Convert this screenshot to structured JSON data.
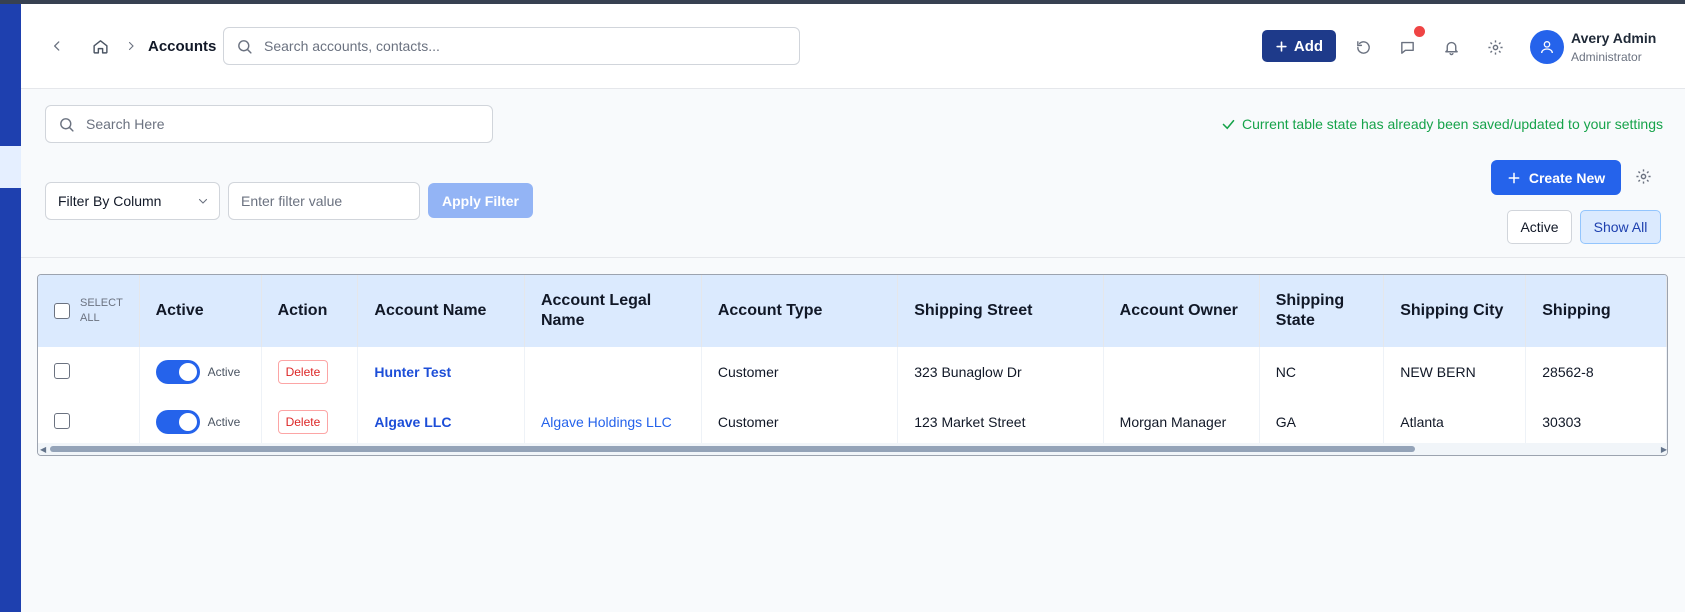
{
  "header": {
    "breadcrumb_current": "Accounts",
    "search_placeholder": "Search accounts, contacts...",
    "add_label": "Add",
    "user_name": "Avery Admin",
    "user_role": "Administrator"
  },
  "controls": {
    "table_search_placeholder": "Search Here",
    "saved_message": "Current table state has already been saved/updated to your settings",
    "filter_column_label": "Filter By Column",
    "filter_value_placeholder": "Enter filter value",
    "apply_filter_label": "Apply Filter",
    "create_new_label": "Create New",
    "active_label": "Active",
    "show_all_label": "Show All"
  },
  "table": {
    "select_all_label": "SELECT ALL",
    "columns": [
      "Active",
      "Action",
      "Account Name",
      "Account Legal Name",
      "Account Type",
      "Shipping Street",
      "Account Owner",
      "Shipping State",
      "Shipping City",
      "Shipping"
    ],
    "rows": [
      {
        "active_label": "Active",
        "action_label": "Delete",
        "account_name": "Hunter Test",
        "legal_name": "",
        "account_type": "Customer",
        "shipping_street": "323 Bunaglow Dr",
        "account_owner": "",
        "shipping_state": "NC",
        "shipping_city": "NEW BERN",
        "shipping_zip": "28562-8"
      },
      {
        "active_label": "Active",
        "action_label": "Delete",
        "account_name": "Algave LLC",
        "legal_name": "Algave Holdings LLC",
        "account_type": "Customer",
        "shipping_street": "123 Market Street",
        "account_owner": "Morgan Manager",
        "shipping_state": "GA",
        "shipping_city": "Atlanta",
        "shipping_zip": "30303"
      }
    ]
  },
  "colors": {
    "primary": "#2563eb",
    "dark_primary": "#1e3a8a",
    "success": "#16a34a",
    "danger": "#dc2626",
    "header_bg": "#dbeafe"
  },
  "icons": [
    "back-chevron-icon",
    "home-icon",
    "chevron-right-icon",
    "search-icon",
    "plus-icon",
    "refresh-icon",
    "chat-icon",
    "bell-icon",
    "gear-icon",
    "user-icon",
    "check-icon",
    "chevron-down-icon"
  ]
}
